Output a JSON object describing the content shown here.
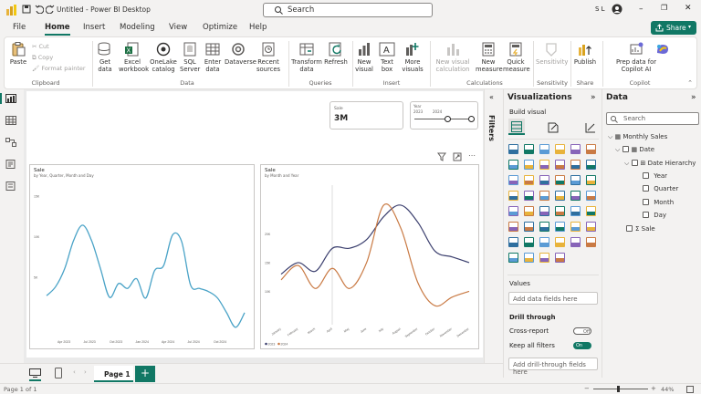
{
  "title_bar": {
    "title": "Untitled - Power BI Desktop",
    "search_placeholder": "Search",
    "user_initials": "S L"
  },
  "menu": {
    "tabs": [
      "File",
      "Home",
      "Insert",
      "Modeling",
      "View",
      "Optimize",
      "Help"
    ],
    "active": "Home",
    "share_label": "Share"
  },
  "ribbon": {
    "clipboard": {
      "paste": "Paste",
      "cut": "Cut",
      "copy": "Copy",
      "format_painter": "Format painter",
      "group": "Clipboard"
    },
    "data": {
      "get_data": "Get data",
      "excel": "Excel workbook",
      "onelake": "OneLake catalog",
      "sql": "SQL Server",
      "enter_data": "Enter data",
      "dataverse": "Dataverse",
      "recent": "Recent sources",
      "group": "Data"
    },
    "queries": {
      "transform": "Transform data",
      "refresh": "Refresh",
      "group": "Queries"
    },
    "insert": {
      "new_visual": "New visual",
      "text_box": "Text box",
      "more_visuals": "More visuals",
      "group": "Insert"
    },
    "calculations": {
      "new_visual_calc": "New visual calculation",
      "new_measure": "New measure",
      "quick_measure": "Quick measure",
      "group": "Calculations"
    },
    "sensitivity": {
      "label": "Sensitivity",
      "group": "Sensitivity"
    },
    "share": {
      "publish": "Publish",
      "group": "Share"
    },
    "copilot": {
      "prep": "Prep data for Copilot AI",
      "copilot": "Copilot",
      "group": "Copilot"
    }
  },
  "canvas": {
    "card": {
      "label": "Sale",
      "value": "3M"
    },
    "slicer": {
      "label": "Year",
      "start": "2023",
      "end": "2024",
      "range_start_fraction": 0.55,
      "range_end_fraction": 0.95
    },
    "left_chart": {
      "title": "Sale",
      "subtitle": "by Year, Quarter, Month and Day",
      "x_ticks": [
        "Apr 2023",
        "Jul 2023",
        "Oct 2023",
        "Jan 2024",
        "Apr 2024",
        "Jul 2024",
        "Oct 2024"
      ],
      "y_ticks": [
        "15K",
        "10K",
        "5K"
      ]
    },
    "right_chart": {
      "title": "Sale",
      "subtitle": "by Month and Year",
      "x_ticks": [
        "January",
        "February",
        "March",
        "April",
        "May",
        "June",
        "July",
        "August",
        "September",
        "October",
        "November",
        "December"
      ],
      "y_ticks": [
        "20K",
        "15K",
        "10K"
      ],
      "legend": [
        "2023",
        "2024"
      ]
    }
  },
  "chart_data": [
    {
      "type": "line",
      "title": "Sale",
      "subtitle": "by Year, Quarter, Month and Day",
      "x": [
        "Feb 2023",
        "Mar 2023",
        "Apr 2023",
        "May 2023",
        "Jun 2023",
        "Jul 2023",
        "Aug 2023",
        "Sep 2023",
        "Oct 2023",
        "Nov 2023",
        "Dec 2023",
        "Jan 2024",
        "Feb 2024",
        "Mar 2024",
        "Apr 2024",
        "May 2024",
        "Jun 2024",
        "Jul 2024",
        "Aug 2024",
        "Sep 2024",
        "Oct 2024",
        "Nov 2024",
        "Dec 2024"
      ],
      "values": [
        2.7,
        3.8,
        6.0,
        9.5,
        11.4,
        9.5,
        6.0,
        2.5,
        4.2,
        3.6,
        4.8,
        2.4,
        5.8,
        6.4,
        10.2,
        9.4,
        4.0,
        3.6,
        3.2,
        2.4,
        0.6,
        -1.2,
        0.6
      ],
      "ylim": [
        -2,
        16
      ],
      "color": "#4aa3c7"
    },
    {
      "type": "line",
      "title": "Sale",
      "subtitle": "by Month and Year",
      "categories": [
        "January",
        "February",
        "March",
        "April",
        "May",
        "June",
        "July",
        "August",
        "September",
        "October",
        "November",
        "December"
      ],
      "series": [
        {
          "name": "2023",
          "color": "#3b3f6e",
          "values": [
            13.0,
            15.0,
            13.5,
            17.5,
            17.5,
            19.0,
            23.0,
            25.0,
            22.0,
            17.0,
            16.0,
            15.0
          ]
        },
        {
          "name": "2024",
          "color": "#c97a44",
          "values": [
            12.0,
            14.5,
            10.5,
            14.0,
            10.5,
            15.0,
            25.0,
            21.0,
            11.5,
            7.5,
            9.0,
            10.0
          ]
        }
      ],
      "ylim": [
        5,
        28
      ]
    }
  ],
  "filters": {
    "label": "Filters"
  },
  "visualizations": {
    "title": "Visualizations",
    "build_visual": "Build visual",
    "values_label": "Values",
    "values_placeholder": "Add data fields here",
    "drill_through": "Drill through",
    "cross_report": "Cross-report",
    "cross_report_state": "Off",
    "keep_all_filters": "Keep all filters",
    "keep_all_filters_state": "On",
    "drill_placeholder": "Add drill-through fields here"
  },
  "data_pane": {
    "title": "Data",
    "search_placeholder": "Search",
    "table": "Monthly Sales",
    "date_field": "Date",
    "hierarchy": "Date Hierarchy",
    "levels": [
      "Year",
      "Quarter",
      "Month",
      "Day"
    ],
    "sale_field": "Sale"
  },
  "page_tabs": {
    "page1": "Page 1"
  },
  "status": {
    "page": "Page 1 of 1",
    "zoom": "44%"
  },
  "colors": {
    "accent": "#117865",
    "line_teal": "#4aa3c7",
    "line_navy": "#3b3f6e",
    "line_orange": "#c97a44"
  }
}
